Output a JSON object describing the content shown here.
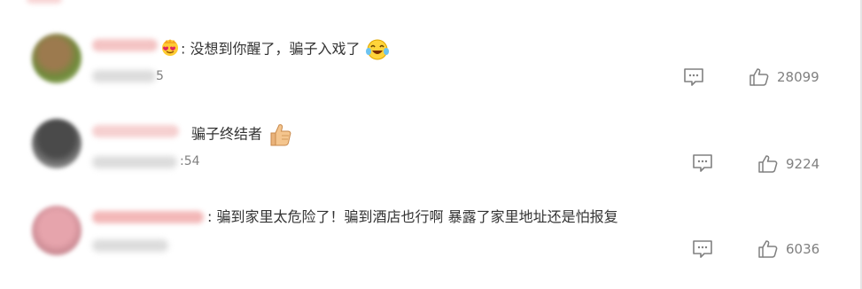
{
  "comments": [
    {
      "colon": ":",
      "text": "没想到你醒了，骗子入戏了",
      "meta_tail": "5",
      "reply_icon": "comment-icon",
      "like_icon": "thumbs-up-icon",
      "likes": "28099"
    },
    {
      "colon": "",
      "text": "骗子终结者",
      "meta_tail": ":54",
      "reply_icon": "comment-icon",
      "like_icon": "thumbs-up-icon",
      "likes": "9224"
    },
    {
      "colon": ":",
      "text": "骗到家里太危险了！骗到酒店也行啊 暴露了家里地址还是怕报复",
      "meta_tail": "",
      "reply_icon": "comment-icon",
      "like_icon": "thumbs-up-icon",
      "likes": "6036"
    }
  ],
  "colors": {
    "meta_gray": "#808080",
    "text": "#333333",
    "username_blur": "#f3b8b8"
  },
  "icons": {
    "badge": "crown-heart-icon",
    "laugh": "laughing-tears-emoji",
    "thumbs": "thumbs-up-emoji"
  }
}
